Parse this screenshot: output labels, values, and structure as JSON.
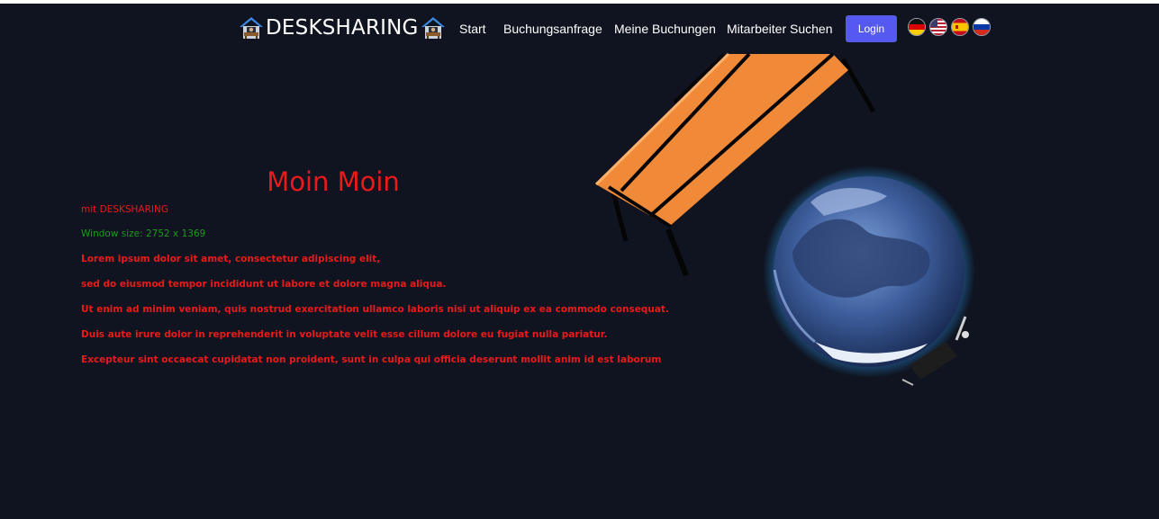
{
  "nav": {
    "brand": "DESKSHARING",
    "brand_icon": "desk-house-icon",
    "links": [
      {
        "label": "Start"
      },
      {
        "label": "Buchungsanfrage"
      },
      {
        "label": "Meine Buchungen"
      },
      {
        "label": "Mitarbeiter Suchen"
      }
    ],
    "login_label": "Login",
    "flags": [
      {
        "icon": "germany-flag-icon"
      },
      {
        "icon": "usa-flag-icon"
      },
      {
        "icon": "spain-flag-icon"
      },
      {
        "icon": "russia-flag-icon"
      }
    ]
  },
  "hero": {
    "title": "Moin Moin",
    "subtitle": "mit DESKSHARING",
    "window_size": "Window size: 2752 x 1369",
    "lines": [
      "Lorem ipsum dolor sit amet, consectetur adipiscing elit,",
      "sed do eiusmod tempor incididunt ut labore et dolore magna aliqua.",
      "Ut enim ad minim veniam, quis nostrud exercitation ullamco laboris nisi ut aliquip ex ea commodo consequat.",
      "Duis aute irure dolor in reprehenderit in voluptate velit esse cillum dolore eu fugiat nulla pariatur.",
      "Excepteur sint occaecat cupidatat non proident, sunt in culpa qui officia deserunt mollit anim id est laborum"
    ]
  },
  "colors": {
    "background": "#0f1420",
    "accent_button": "#5559f0",
    "hero_text": "#ea1a1a",
    "window_size_text": "#1e9a1e",
    "desk_orange": "#f08a38"
  },
  "illustrations": {
    "desk": "desk-illustration",
    "globe": "globe-illustration"
  }
}
